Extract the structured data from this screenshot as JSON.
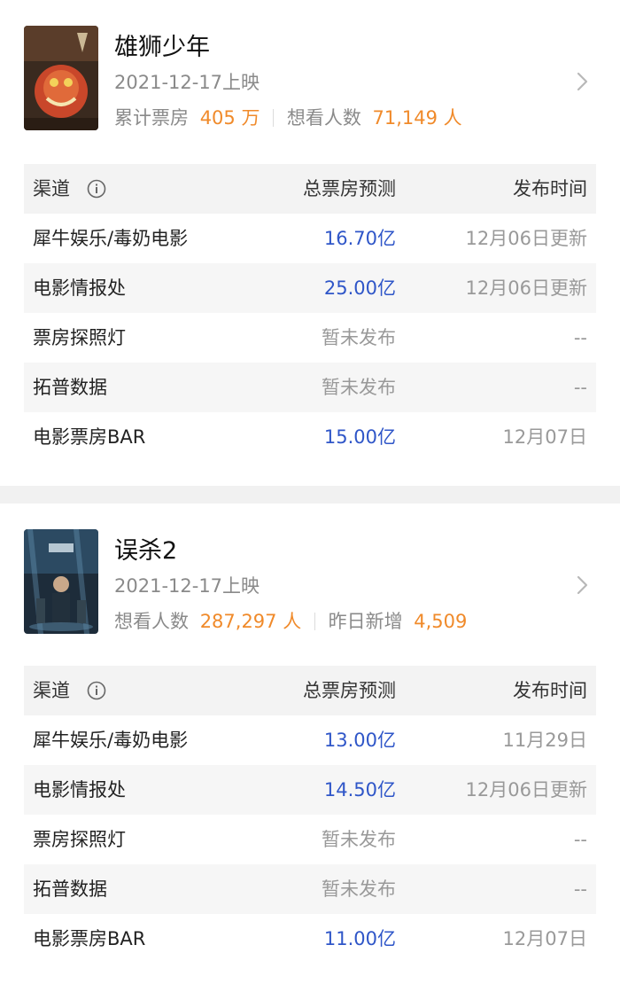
{
  "colors": {
    "accent_orange": "#f08a2a",
    "value_blue": "#2f56c8",
    "muted": "#999999"
  },
  "movies": [
    {
      "title": "雄狮少年",
      "release": "2021-12-17上映",
      "stat1_label": "累计票房",
      "stat1_value": "405 万",
      "stat2_label": "想看人数",
      "stat2_value": "71,149 人",
      "headers": {
        "channel": "渠道",
        "forecast": "总票房预测",
        "time": "发布时间"
      },
      "rows": [
        {
          "channel": "犀牛娱乐/毒奶电影",
          "forecast": "16.70亿",
          "time": "12月06日更新"
        },
        {
          "channel": "电影情报处",
          "forecast": "25.00亿",
          "time": "12月06日更新"
        },
        {
          "channel": "票房探照灯",
          "forecast": "暂未发布",
          "time": "--"
        },
        {
          "channel": "拓普数据",
          "forecast": "暂未发布",
          "time": "--"
        },
        {
          "channel": "电影票房BAR",
          "forecast": "15.00亿",
          "time": "12月07日"
        }
      ]
    },
    {
      "title": "误杀2",
      "release": "2021-12-17上映",
      "stat1_label": "想看人数",
      "stat1_value": "287,297 人",
      "stat2_label": "昨日新增",
      "stat2_value": "4,509",
      "headers": {
        "channel": "渠道",
        "forecast": "总票房预测",
        "time": "发布时间"
      },
      "rows": [
        {
          "channel": "犀牛娱乐/毒奶电影",
          "forecast": "13.00亿",
          "time": "11月29日"
        },
        {
          "channel": "电影情报处",
          "forecast": "14.50亿",
          "time": "12月06日更新"
        },
        {
          "channel": "票房探照灯",
          "forecast": "暂未发布",
          "time": "--"
        },
        {
          "channel": "拓普数据",
          "forecast": "暂未发布",
          "time": "--"
        },
        {
          "channel": "电影票房BAR",
          "forecast": "11.00亿",
          "time": "12月07日"
        }
      ]
    }
  ]
}
